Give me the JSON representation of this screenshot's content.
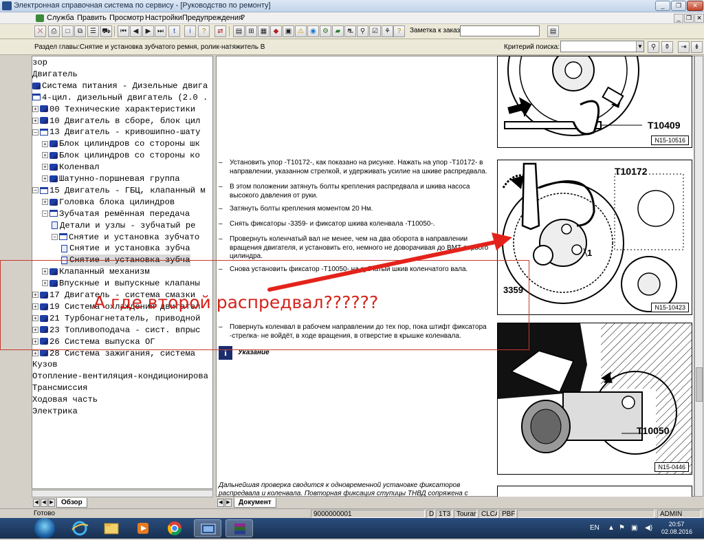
{
  "window": {
    "title": "Электронная справочная система по сервису - [Руководство по ремонту]",
    "buttons": [
      "_",
      "❐",
      "✕"
    ]
  },
  "menubar": {
    "items": [
      "Служба",
      "Править",
      "Просмотр",
      "Настройки",
      "Предупреждения",
      "?"
    ],
    "mdi_buttons": [
      "_",
      "❐",
      "✕"
    ]
  },
  "toolbar": {
    "note_label": "Заметка к заказу:",
    "note_value": ""
  },
  "chapter": {
    "text": "Раздел главы:Снятие и установка зубчатого ремня, ролик-натяжитель B",
    "criteria_label": "Критерий поиска:",
    "criteria_value": ""
  },
  "tree": {
    "rows": [
      {
        "indent": 0,
        "icon": "none",
        "expander": "",
        "label": "зор"
      },
      {
        "indent": 0,
        "icon": "none",
        "expander": "",
        "label": "Двигатель"
      },
      {
        "indent": 0,
        "icon": "book-closed",
        "expander": "",
        "label": "Система питания - Дизельные двига"
      },
      {
        "indent": 0,
        "icon": "book-open",
        "expander": "",
        "label": "4-цил. дизельный двигатель (2.0 ."
      },
      {
        "indent": 0,
        "icon": "book-closed",
        "expander": "+",
        "label": "00 Технические характеристики"
      },
      {
        "indent": 0,
        "icon": "book-closed",
        "expander": "+",
        "label": "10 Двигатель в сборе, блок цил"
      },
      {
        "indent": 0,
        "icon": "book-open",
        "expander": "−",
        "label": "13 Двигатель - кривошипно-шату"
      },
      {
        "indent": 1,
        "icon": "book-closed",
        "expander": "+",
        "label": "Блок цилиндров со стороны шк"
      },
      {
        "indent": 1,
        "icon": "book-closed",
        "expander": "+",
        "label": "Блок цилиндров со стороны ко"
      },
      {
        "indent": 1,
        "icon": "book-closed",
        "expander": "+",
        "label": "Коленвал"
      },
      {
        "indent": 1,
        "icon": "book-closed",
        "expander": "+",
        "label": "Шатунно-поршневая группа"
      },
      {
        "indent": 0,
        "icon": "book-open",
        "expander": "−",
        "label": "15 Двигатель - ГБЦ, клапанный м"
      },
      {
        "indent": 1,
        "icon": "book-closed",
        "expander": "+",
        "label": "Головка блока цилиндров"
      },
      {
        "indent": 1,
        "icon": "book-open",
        "expander": "−",
        "label": "Зубчатая ремённая передача"
      },
      {
        "indent": 2,
        "icon": "doc",
        "expander": "",
        "label": "Детали и узлы - зубчатый ре"
      },
      {
        "indent": 2,
        "icon": "book-open",
        "expander": "−",
        "label": "Снятие и установка зубчато"
      },
      {
        "indent": 3,
        "icon": "doc",
        "expander": "",
        "label": "Снятие и установка зубча"
      },
      {
        "indent": 3,
        "icon": "doc",
        "expander": "",
        "label": "Снятие и установка зубча",
        "selected": true
      },
      {
        "indent": 1,
        "icon": "book-closed",
        "expander": "+",
        "label": "Клапанный механизм"
      },
      {
        "indent": 1,
        "icon": "book-closed",
        "expander": "+",
        "label": "Впускные и выпускные клапаны"
      },
      {
        "indent": 0,
        "icon": "book-closed",
        "expander": "+",
        "label": "17 Двигатель - система смазки"
      },
      {
        "indent": 0,
        "icon": "book-closed",
        "expander": "+",
        "label": "19 Система охлаждения двигател"
      },
      {
        "indent": 0,
        "icon": "book-closed",
        "expander": "+",
        "label": "21 Турбонагнетатель, приводной"
      },
      {
        "indent": 0,
        "icon": "book-closed",
        "expander": "+",
        "label": "23 Топливоподача - сист. впрыс"
      },
      {
        "indent": 0,
        "icon": "book-closed",
        "expander": "+",
        "label": "26 Система выпуска ОГ"
      },
      {
        "indent": 0,
        "icon": "book-closed",
        "expander": "+",
        "label": "28 Система зажигания, система"
      },
      {
        "indent": 0,
        "icon": "none",
        "expander": "",
        "label": "Кузов"
      },
      {
        "indent": 0,
        "icon": "none",
        "expander": "",
        "label": "Отопление-вентиляция-кондиционирова"
      },
      {
        "indent": 0,
        "icon": "none",
        "expander": "",
        "label": "Трансмиссия"
      },
      {
        "indent": 0,
        "icon": "none",
        "expander": "",
        "label": "Ходовая часть"
      },
      {
        "indent": 0,
        "icon": "none",
        "expander": "",
        "label": "Электрика"
      }
    ],
    "tab_label": "Обзор"
  },
  "document": {
    "steps": [
      "Установить упор -T10172-, как показано на рисунке. Нажать на упор -T10172- в направлении, указанном стрелкой, и удерживать усилие на шкиве распредвала.",
      "В этом положении затянуть болты крепления распредвала и шкива насоса высокого давления от руки.",
      "Затянуть болты крепления моментом 20 Нм.",
      "Снять фиксаторы -3359- и фиксатор шкива коленвала -T10050-.",
      "Провернуть коленчатый вал не менее, чем на два оборота в направлении вращения двигателя, и установить его, немного не доворачивая до ВМТ первого цилиндра.",
      "Снова установить фиксатор -T10050- на зубчатый шкив коленчатого вала.",
      "Повернуть коленвал в рабочем направлении до тех пор, пока штифт фиксатора -стрелка- не войдёт, в ходе вращения, в отверстие в крышке коленвала."
    ],
    "dash": "–",
    "hint_icon": "i",
    "hint_label": "Указание",
    "footnote": "Дальнейшая проверка сводится к одновременной установке фиксаторов распредвала и коленвала. Повторная фиксация ступицы ТНВД сопряжена с",
    "tab_label": "Документ",
    "figures": [
      {
        "labels": [
          "T10409"
        ],
        "code": "N15-10516"
      },
      {
        "labels": [
          "T10172",
          "1",
          "3359"
        ],
        "code": "N15-10423"
      },
      {
        "labels": [
          "T10050"
        ],
        "code": "N15-0446"
      }
    ]
  },
  "annotation": {
    "text": "А где второй распредвал??????",
    "color": "#d4231b"
  },
  "statusbar": {
    "ready": "Готово",
    "cells": [
      "9000000001",
      "D",
      "1T3",
      "Touran",
      "CLCA",
      "PBF"
    ],
    "user": "ADMIN"
  },
  "taskbar": {
    "lang": "EN",
    "time": "20:57",
    "date": "02.08.2016"
  }
}
